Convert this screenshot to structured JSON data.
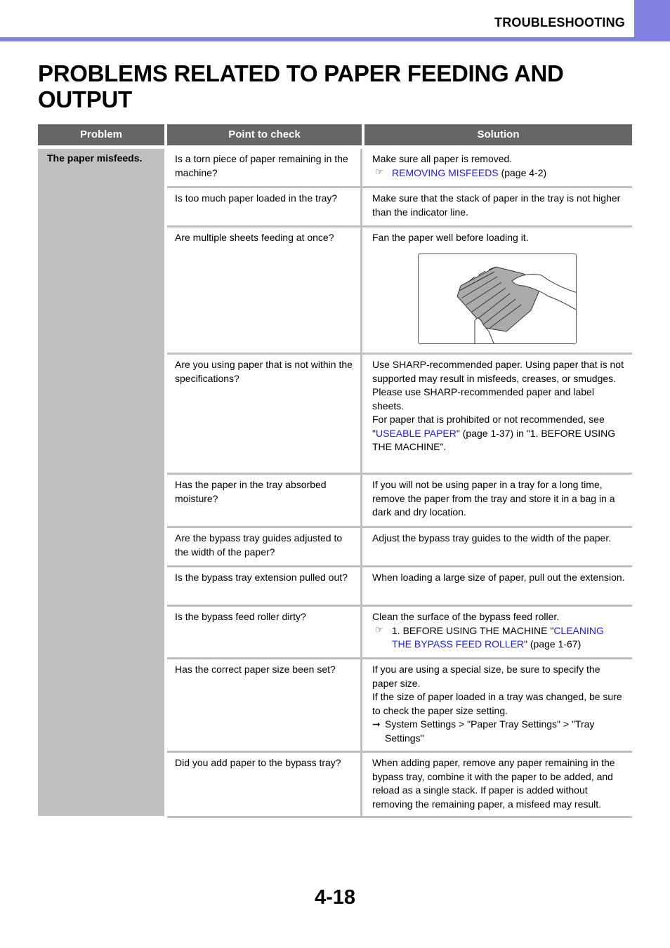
{
  "header": {
    "section": "TROUBLESHOOTING",
    "accent_color": "#8080e0"
  },
  "page_title": "PROBLEMS RELATED TO PAPER FEEDING AND OUTPUT",
  "table": {
    "headers": [
      "Problem",
      "Point to check",
      "Solution"
    ],
    "problem": "The paper misfeeds.",
    "rows": [
      {
        "check": "Is a torn piece of paper remaining in the machine?",
        "solution": "Make sure all paper is removed.",
        "ref_link": "REMOVING MISFEEDS",
        "ref_suffix": " (page 4-2)"
      },
      {
        "check": "Is too much paper loaded in the tray?",
        "solution": "Make sure that the stack of paper in the tray is not higher than the indicator line."
      },
      {
        "check": "Are multiple sheets feeding at once?",
        "solution": "Fan the paper well before loading it.",
        "illustration": "fanning-paper-illustration"
      },
      {
        "check": "Are you using paper that is not within the specifications?",
        "solution_p1": "Use SHARP-recommended paper. Using paper that is not supported may result in misfeeds, creases, or smudges.",
        "solution_p2": "Please use SHARP-recommended paper and label sheets.",
        "solution_p3_pre": "For paper that is prohibited or not recommended, see \"",
        "solution_p3_link": "USEABLE PAPER",
        "solution_p3_post": "\" (page 1-37) in \"1. BEFORE USING THE MACHINE\"."
      },
      {
        "check": "Has the paper in the tray absorbed moisture?",
        "solution": "If you will not be using paper in a tray for a long time, remove the paper from the tray and store it in a bag in a dark and dry location."
      },
      {
        "check": "Are the bypass tray guides adjusted to the width of the paper?",
        "solution": "Adjust the bypass tray guides to the width of the paper."
      },
      {
        "check": "Is the bypass tray extension pulled out?",
        "solution": "When loading a large size of paper, pull out the extension."
      },
      {
        "check": "Is the bypass feed roller dirty?",
        "solution": "Clean the surface of the bypass feed roller.",
        "ref_pre": "1. BEFORE USING THE MACHINE \"",
        "ref_link": "CLEANING THE BYPASS FEED ROLLER",
        "ref_suffix": "\" (page 1-67)"
      },
      {
        "check": "Has the correct paper size been set?",
        "solution_p1": "If you are using a special size, be sure to specify the paper size.",
        "solution_p2": "If the size of paper loaded in a tray was changed, be sure to check the paper size setting.",
        "path": "System Settings > \"Paper Tray Settings\" > \"Tray Settings\""
      },
      {
        "check": "Did you add paper to the bypass tray?",
        "solution": "When adding paper, remove any paper remaining in the bypass tray, combine it with the paper to be added, and reload as a single stack. If paper is added without removing the remaining paper, a misfeed may result."
      }
    ],
    "icons": {
      "reference": "☞",
      "arrow": "➞"
    }
  },
  "page_number": "4-18"
}
